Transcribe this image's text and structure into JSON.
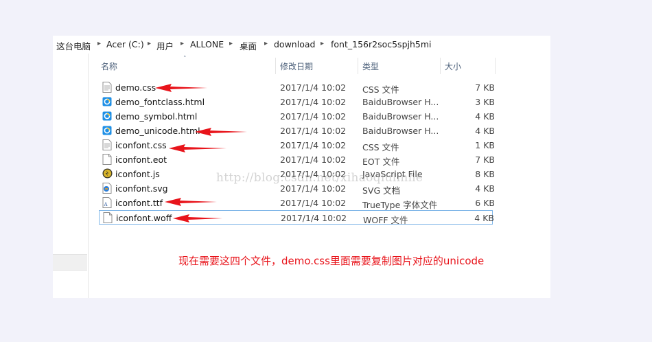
{
  "breadcrumb": [
    "这台电脑",
    "Acer (C:)",
    "用户",
    "ALLONE",
    "桌面",
    "download",
    "font_156r2soc5spjh5mi"
  ],
  "breadcrumb_separator": "▸",
  "columns": {
    "name": "名称",
    "date": "修改日期",
    "type": "类型",
    "size": "大小"
  },
  "sort_indicator": "˄",
  "files": [
    {
      "name": "demo.css",
      "date": "2017/1/4 10:02",
      "type": "CSS 文件",
      "size": "7 KB",
      "icon": "css-file-icon"
    },
    {
      "name": "demo_fontclass.html",
      "date": "2017/1/4 10:02",
      "type": "BaiduBrowser H...",
      "size": "3 KB",
      "icon": "browser-html-icon"
    },
    {
      "name": "demo_symbol.html",
      "date": "2017/1/4 10:02",
      "type": "BaiduBrowser H...",
      "size": "4 KB",
      "icon": "browser-html-icon"
    },
    {
      "name": "demo_unicode.html",
      "date": "2017/1/4 10:02",
      "type": "BaiduBrowser H...",
      "size": "4 KB",
      "icon": "browser-html-icon"
    },
    {
      "name": "iconfont.css",
      "date": "2017/1/4 10:02",
      "type": "CSS 文件",
      "size": "1 KB",
      "icon": "css-file-icon"
    },
    {
      "name": "iconfont.eot",
      "date": "2017/1/4 10:02",
      "type": "EOT 文件",
      "size": "7 KB",
      "icon": "blank-file-icon"
    },
    {
      "name": "iconfont.js",
      "date": "2017/1/4 10:02",
      "type": "JavaScript File",
      "size": "8 KB",
      "icon": "javascript-file-icon"
    },
    {
      "name": "iconfont.svg",
      "date": "2017/1/4 10:02",
      "type": "SVG 文档",
      "size": "4 KB",
      "icon": "svg-file-icon"
    },
    {
      "name": "iconfont.ttf",
      "date": "2017/1/4 10:02",
      "type": "TrueType 字体文件",
      "size": "6 KB",
      "icon": "font-file-icon"
    },
    {
      "name": "iconfont.woff",
      "date": "2017/1/4 10:02",
      "type": "WOFF 文件",
      "size": "4 KB",
      "icon": "blank-file-icon"
    }
  ],
  "selected_file": "iconfont.woff",
  "annotation_text": "现在需要这四个文件，demo.css里面需要复制图片对应的unicode",
  "watermark_text": "http://blog.csdn.net/xihaoqiulinhe",
  "colors": {
    "arrow": "#e8141b",
    "annotation": "#e8141b",
    "header_text": "#4c607a",
    "selection_border": "#7fb6e8"
  }
}
